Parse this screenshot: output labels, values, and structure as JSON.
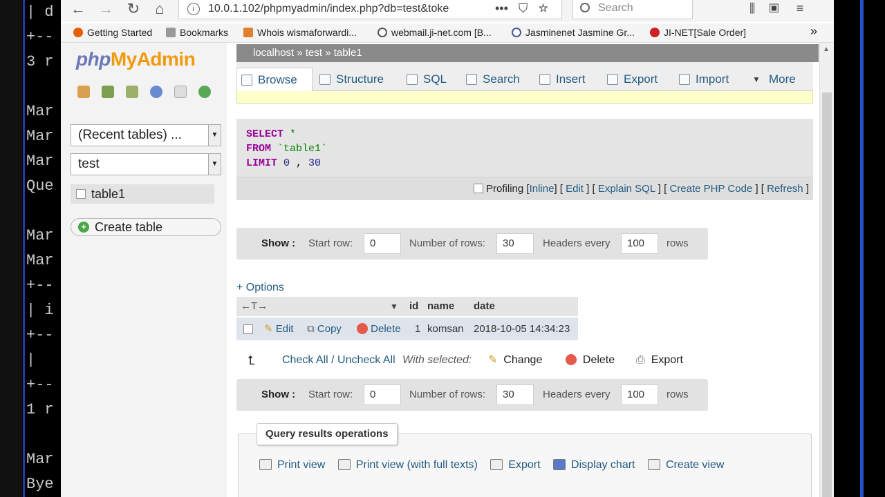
{
  "terminal": {
    "lines": [
      "| d",
      "+--",
      "3 r",
      "",
      "Mar",
      "Mar",
      "Mar",
      "Que",
      "",
      "Mar",
      "Mar",
      "+--",
      "| i",
      "+--",
      "|",
      "+--",
      "1 r",
      "",
      "Mar",
      "Bye"
    ]
  },
  "browser": {
    "url": "10.0.1.102/phpmyadmin/index.php?db=test&toke",
    "search_placeholder": "Search",
    "bookmarks": [
      {
        "label": "Getting Started",
        "color": "#e66000"
      },
      {
        "label": "Bookmarks",
        "color": "#888888"
      },
      {
        "label": "Whois wismaforwardi...",
        "color": "#e08030"
      },
      {
        "label": "webmail.ji-net.com [B...",
        "color": "#555555"
      },
      {
        "label": "Jasminenet Jasmine Gr...",
        "color": "#445599"
      },
      {
        "label": "JI-NET[Sale Order]",
        "color": "#cc2222"
      }
    ],
    "more_bookmarks": "»"
  },
  "sidebar": {
    "logo_php": "php",
    "logo_myadmin": "MyAdmin",
    "recent_tables": "(Recent tables) ...",
    "database": "test",
    "table": "table1",
    "create_table": "Create table"
  },
  "breadcrumb": {
    "server": "localhost",
    "database": "test",
    "table": "table1",
    "sep": "»"
  },
  "tabs": [
    "Browse",
    "Structure",
    "SQL",
    "Search",
    "Insert",
    "Export",
    "Import",
    "More"
  ],
  "sql": {
    "select_kw": "SELECT",
    "select_val": " *",
    "from_kw": "FROM",
    "from_val": " `table1`",
    "limit_kw": "LIMIT",
    "limit_a": " 0",
    "limit_sep": " , ",
    "limit_b": "30"
  },
  "sql_links": {
    "profiling": "Profiling",
    "inline": "Inline",
    "edit": "Edit",
    "explain": "Explain SQL",
    "create_php": "Create PHP Code",
    "refresh": "Refresh"
  },
  "nav_form": {
    "show": "Show :",
    "start_row_label": "Start row:",
    "start_row": "0",
    "num_rows_label": "Number of rows:",
    "num_rows": "30",
    "headers_every_label": "Headers every",
    "headers_every": "100",
    "rows_label": "rows"
  },
  "options_label": "+ Options",
  "results": {
    "columns": [
      "id",
      "name",
      "date"
    ],
    "row": {
      "id": "1",
      "name": "komsan",
      "date": "2018-10-05 14:34:23"
    },
    "row_actions": [
      "Edit",
      "Copy",
      "Delete"
    ]
  },
  "with_selected": {
    "check_all": "Check All / Uncheck All",
    "label": "With selected:",
    "change": "Change",
    "delete": "Delete",
    "export": "Export"
  },
  "query_ops": {
    "title": "Query results operations",
    "actions": [
      "Print view",
      "Print view (with full texts)",
      "Export",
      "Display chart",
      "Create view"
    ]
  }
}
